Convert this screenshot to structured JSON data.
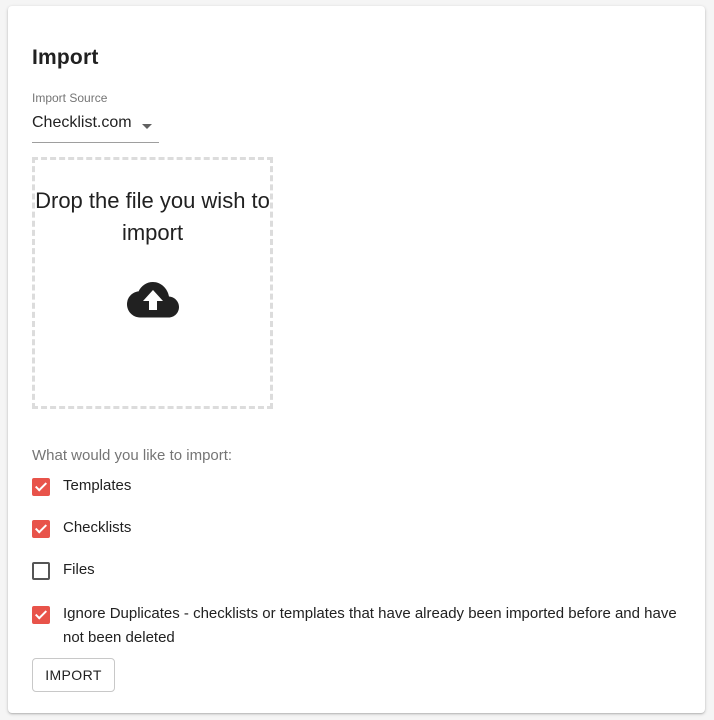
{
  "title": "Import",
  "import_source": {
    "label": "Import Source",
    "value": "Checklist.com"
  },
  "dropzone": {
    "text": "Drop the file you wish to import",
    "icon": "cloud-upload-icon"
  },
  "options_prompt": "What would you like to import:",
  "options": [
    {
      "label": "Templates",
      "checked": true
    },
    {
      "label": "Checklists",
      "checked": true
    },
    {
      "label": "Files",
      "checked": false
    },
    {
      "label": "Ignore Duplicates - checklists or templates that have already been imported before and have not been deleted",
      "checked": true
    }
  ],
  "import_button": "IMPORT",
  "colors": {
    "accent": "#e8534a",
    "text": "#212121",
    "muted": "#757575"
  }
}
